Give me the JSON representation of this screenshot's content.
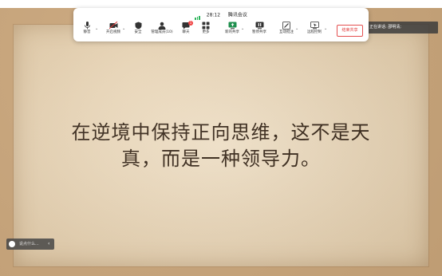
{
  "window": {
    "time": "28:12",
    "app_title": "腾讯会议"
  },
  "toolbar": {
    "items": [
      {
        "label": "静音",
        "icon": "microphone-icon"
      },
      {
        "label": "开启视频",
        "icon": "video-off-icon"
      },
      {
        "label": "安全",
        "icon": "shield-icon"
      },
      {
        "label": "管理成员(10)",
        "icon": "members-icon"
      },
      {
        "label": "聊天",
        "icon": "chat-icon",
        "badge": "1"
      },
      {
        "label": "更多",
        "icon": "more-icon"
      },
      {
        "label": "新的共享",
        "icon": "share-screen-icon"
      },
      {
        "label": "暂停共享",
        "icon": "pause-share-icon"
      },
      {
        "label": "互动批注",
        "icon": "annotate-icon"
      },
      {
        "label": "远程控制",
        "icon": "remote-control-icon"
      }
    ],
    "end_share_label": "结束共享"
  },
  "speaking": {
    "text": "正在讲话: 邵明清;"
  },
  "slide": {
    "line1": "在逆境中保持正向思维，这不是天",
    "line2": "真，而是一种领导力。"
  },
  "chat": {
    "placeholder": "说点什么..."
  },
  "colors": {
    "accent_red": "#e23a3a",
    "signal_green": "#2bb45a",
    "paper": "#ead6b6",
    "frame": "#c9a57a"
  }
}
